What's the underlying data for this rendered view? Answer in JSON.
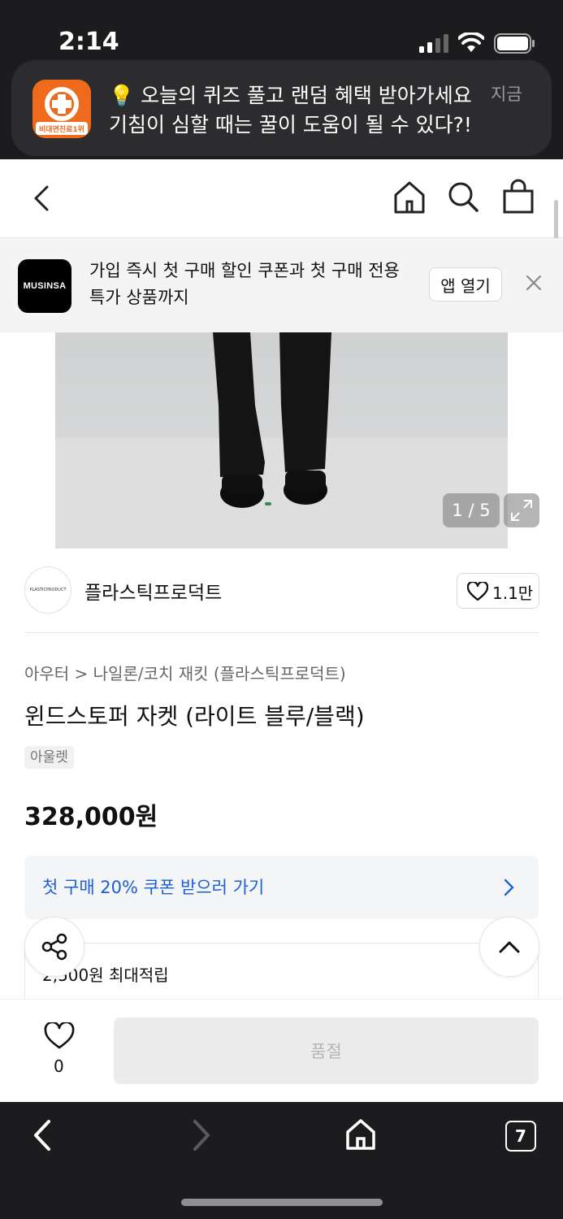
{
  "status_bar": {
    "time": "2:14"
  },
  "notification": {
    "app_icon_text": "비대면진료1위",
    "title": "💡 오늘의 퀴즈 풀고 랜덤 혜택 받아가세요",
    "body": "기침이 심할 때는 꿀이 도움이 될 수 있다?!",
    "time": "지금"
  },
  "app_banner": {
    "logo_text": "MUSINSA",
    "text": "가입 즉시 첫 구매 할인 쿠폰과 첫 구매 전용 특가 상품까지",
    "open_label": "앱 열기"
  },
  "gallery": {
    "counter": "1 / 5"
  },
  "brand": {
    "logo_text": "PLASTICPRODUCT",
    "name": "플라스틱프로덕트",
    "likes": "1.1만"
  },
  "product": {
    "breadcrumb": "아우터 > 나일론/코치 재킷 (플라스틱프로덕트)",
    "title": "윈드스토퍼 자켓 (라이트 블루/블랙)",
    "badge": "아울렛",
    "price": "328,000원",
    "coupon": "첫 구매 20% 쿠폰 받으러 가기",
    "points": "2,500원 최대적립"
  },
  "buy_bar": {
    "wish_count": "0",
    "soldout_label": "품절"
  },
  "safari": {
    "tab_count": "7"
  },
  "colors": {
    "accent_blue": "#1a5fd6",
    "notif_orange": "#f06a1d"
  }
}
